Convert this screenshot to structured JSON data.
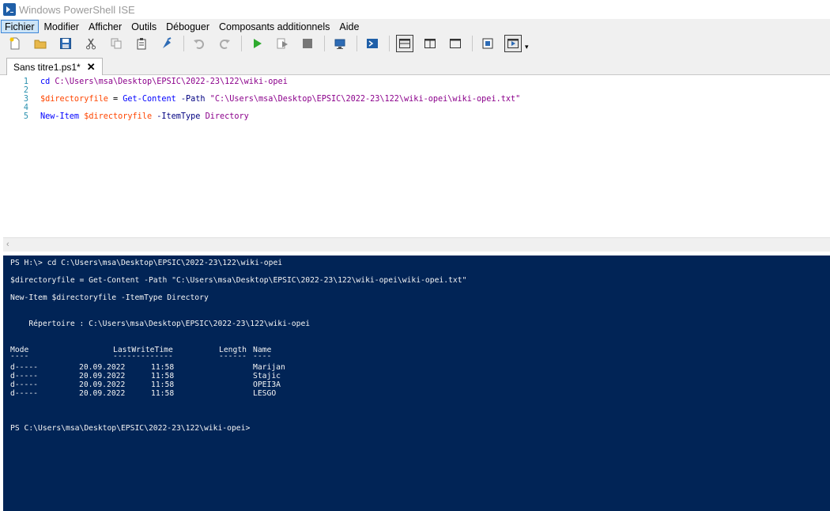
{
  "window": {
    "title": "Windows PowerShell ISE",
    "app_icon": "powershell-icon"
  },
  "menu": {
    "items": [
      "Fichier",
      "Modifier",
      "Afficher",
      "Outils",
      "Déboguer",
      "Composants additionnels",
      "Aide"
    ],
    "active": "Fichier"
  },
  "toolbar": {
    "icons": [
      "new-file-icon",
      "open-folder-icon",
      "save-icon",
      "cut-icon",
      "copy-icon",
      "paste-icon",
      "clear-icon",
      "undo-icon",
      "redo-icon",
      "run-icon",
      "run-selection-icon",
      "stop-icon",
      "remote-icon",
      "powershell-console-icon",
      "layout-top-icon",
      "layout-right-icon",
      "layout-max-icon",
      "show-commands-icon",
      "addon-pane-icon"
    ],
    "more": "▾"
  },
  "tab": {
    "label": "Sans titre1.ps1*",
    "close": "✕"
  },
  "editor": {
    "lines": [
      {
        "n": "1",
        "parts": [
          [
            "cmd",
            "cd"
          ],
          [
            "plain",
            " "
          ],
          [
            "str",
            "C:\\Users\\msa\\Desktop\\EPSIC\\2022-23\\122\\wiki-opei"
          ]
        ]
      },
      {
        "n": "2",
        "parts": []
      },
      {
        "n": "3",
        "parts": [
          [
            "var",
            "$directoryfile"
          ],
          [
            "plain",
            " = "
          ],
          [
            "cmd",
            "Get-Content"
          ],
          [
            "plain",
            " "
          ],
          [
            "param",
            "-Path"
          ],
          [
            "plain",
            " "
          ],
          [
            "str",
            "\"C:\\Users\\msa\\Desktop\\EPSIC\\2022-23\\122\\wiki-opei\\wiki-opei.txt\""
          ]
        ]
      },
      {
        "n": "4",
        "parts": []
      },
      {
        "n": "5",
        "parts": [
          [
            "cmd",
            "New-Item"
          ],
          [
            "plain",
            " "
          ],
          [
            "var",
            "$directoryfile"
          ],
          [
            "plain",
            " "
          ],
          [
            "param",
            "-ItemType"
          ],
          [
            "plain",
            " "
          ],
          [
            "str",
            "Directory"
          ]
        ]
      }
    ]
  },
  "console": {
    "cmd1": "PS H:\\> cd C:\\Users\\msa\\Desktop\\EPSIC\\2022-23\\122\\wiki-opei",
    "cmd2": "$directoryfile = Get-Content -Path \"C:\\Users\\msa\\Desktop\\EPSIC\\2022-23\\122\\wiki-opei\\wiki-opei.txt\"",
    "cmd3": "New-Item $directoryfile -ItemType Directory",
    "directory": "    Répertoire : C:\\Users\\msa\\Desktop\\EPSIC\\2022-23\\122\\wiki-opei",
    "headers": {
      "mode": "Mode",
      "lwt": "LastWriteTime",
      "length": "Length",
      "name": "Name"
    },
    "underlines": {
      "mode": "----",
      "lwt": "-------------",
      "length": "------",
      "name": "----"
    },
    "rows": [
      {
        "mode": "d-----",
        "date": "20.09.2022",
        "time": "11:58",
        "name": "Marijan"
      },
      {
        "mode": "d-----",
        "date": "20.09.2022",
        "time": "11:58",
        "name": "Stajic"
      },
      {
        "mode": "d-----",
        "date": "20.09.2022",
        "time": "11:58",
        "name": "OPEI3A"
      },
      {
        "mode": "d-----",
        "date": "20.09.2022",
        "time": "11:58",
        "name": "LESGO"
      }
    ],
    "prompt": "PS C:\\Users\\msa\\Desktop\\EPSIC\\2022-23\\122\\wiki-opei>"
  }
}
